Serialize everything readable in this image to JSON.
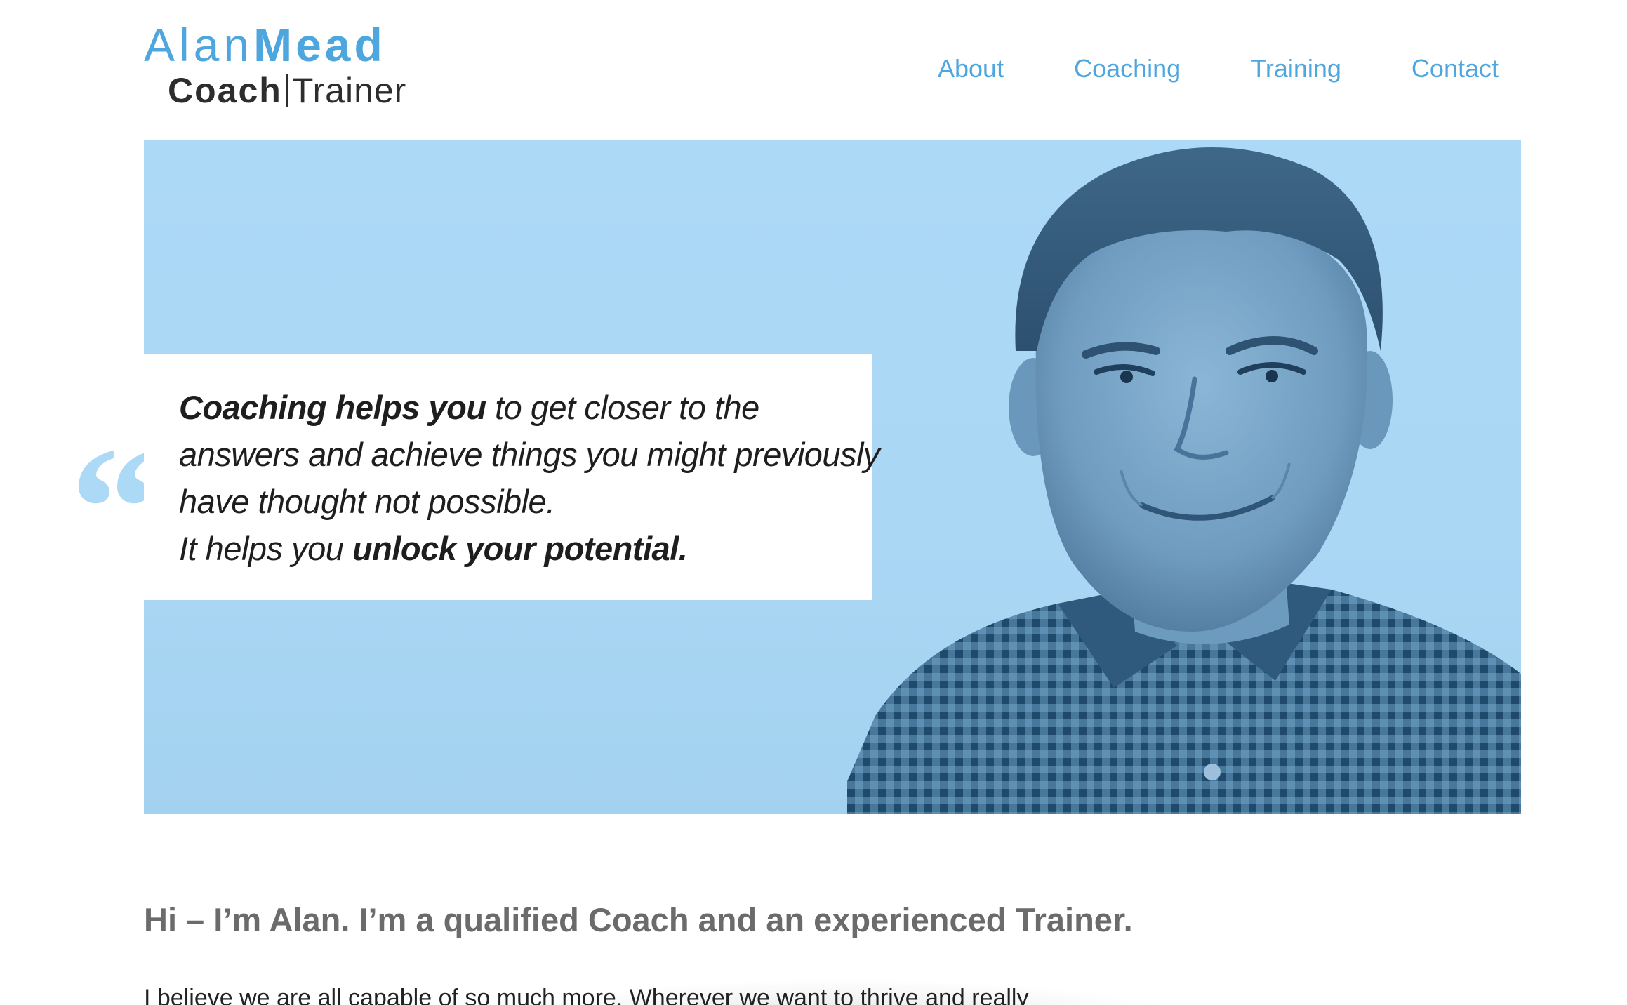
{
  "logo": {
    "first": "Alan",
    "last": "Mead",
    "coach": "Coach",
    "trainer": "Trainer"
  },
  "nav": {
    "items": [
      {
        "label": "About"
      },
      {
        "label": "Coaching"
      },
      {
        "label": "Training"
      },
      {
        "label": "Contact"
      }
    ]
  },
  "hero": {
    "quote_mark": "“",
    "quote": {
      "line1_bold": "Coaching helps you",
      "line1_rest": " to get closer to the",
      "line2": "answers and achieve things you might previously",
      "line3": "have thought not possible.",
      "line4_start": "It helps you ",
      "line4_bold": "unlock your potential."
    },
    "portrait_alt": "Portrait of Alan Mead"
  },
  "intro": {
    "heading": "Hi – I’m Alan. I’m a qualified Coach and an experienced Trainer.",
    "paragraph_start": "I believe we are all capable of so much more. Wherever we want to thrive and really"
  },
  "colors": {
    "accent": "#4ea6de",
    "hero_bg": "#acd9f6",
    "heading_gray": "#6b6b6b",
    "text_dark": "#222222"
  }
}
